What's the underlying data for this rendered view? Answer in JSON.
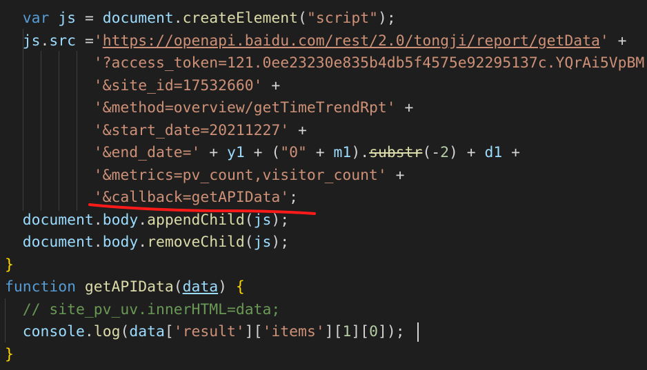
{
  "editor": {
    "lines": [
      [
        {
          "text": "  "
        },
        {
          "text": "var",
          "cls": "k"
        },
        {
          "text": " "
        },
        {
          "text": "js",
          "cls": "v"
        },
        {
          "text": " = "
        },
        {
          "text": "document",
          "cls": "v"
        },
        {
          "text": "."
        },
        {
          "text": "createElement",
          "cls": "f"
        },
        {
          "text": "("
        },
        {
          "text": "\"script\"",
          "cls": "s"
        },
        {
          "text": ");"
        }
      ],
      [
        {
          "text": "  "
        },
        {
          "text": "js",
          "cls": "v"
        },
        {
          "text": "."
        },
        {
          "text": "src",
          "cls": "v"
        },
        {
          "text": " ="
        },
        {
          "text": "'",
          "cls": "s"
        },
        {
          "text": "https://openapi.baidu.com/rest/2.0/tongji/report/getData",
          "cls": "s link"
        },
        {
          "text": "'",
          "cls": "s"
        },
        {
          "text": " +"
        }
      ],
      [
        {
          "text": "          "
        },
        {
          "text": "'?access_token=121.0ee23230e835b4db5f4575e92295137c.YQrAi5VpBM",
          "cls": "s"
        }
      ],
      [
        {
          "text": "          "
        },
        {
          "text": "'&site_id=17532660'",
          "cls": "s"
        },
        {
          "text": " +"
        }
      ],
      [
        {
          "text": "          "
        },
        {
          "text": "'&method=overview/getTimeTrendRpt'",
          "cls": "s"
        },
        {
          "text": " +"
        }
      ],
      [
        {
          "text": "          "
        },
        {
          "text": "'&start_date=20211227'",
          "cls": "s"
        },
        {
          "text": " +"
        }
      ],
      [
        {
          "text": "          "
        },
        {
          "text": "'&end_date='",
          "cls": "s"
        },
        {
          "text": " + "
        },
        {
          "text": "y1",
          "cls": "v"
        },
        {
          "text": " + ("
        },
        {
          "text": "\"0\"",
          "cls": "s"
        },
        {
          "text": " + "
        },
        {
          "text": "m1",
          "cls": "v"
        },
        {
          "text": ")."
        },
        {
          "text": "substr",
          "cls": "f strike"
        },
        {
          "text": "(-"
        },
        {
          "text": "2",
          "cls": "n"
        },
        {
          "text": ") + "
        },
        {
          "text": "d1",
          "cls": "v"
        },
        {
          "text": " +"
        }
      ],
      [
        {
          "text": "          "
        },
        {
          "text": "'&metrics=pv_count,visitor_count'",
          "cls": "s"
        },
        {
          "text": " +"
        }
      ],
      [
        {
          "text": "          "
        },
        {
          "text": "'&callback=getAPIData'",
          "cls": "s"
        },
        {
          "text": ";"
        }
      ],
      [
        {
          "text": "  "
        },
        {
          "text": "document",
          "cls": "v"
        },
        {
          "text": "."
        },
        {
          "text": "body",
          "cls": "v"
        },
        {
          "text": "."
        },
        {
          "text": "appendChild",
          "cls": "f"
        },
        {
          "text": "("
        },
        {
          "text": "js",
          "cls": "v"
        },
        {
          "text": ");"
        }
      ],
      [
        {
          "text": "  "
        },
        {
          "text": "document",
          "cls": "v"
        },
        {
          "text": "."
        },
        {
          "text": "body",
          "cls": "v"
        },
        {
          "text": "."
        },
        {
          "text": "removeChild",
          "cls": "f"
        },
        {
          "text": "("
        },
        {
          "text": "js",
          "cls": "v"
        },
        {
          "text": ");"
        }
      ],
      [
        {
          "text": "}",
          "cls": "y"
        }
      ],
      [
        {
          "text": "function",
          "cls": "k"
        },
        {
          "text": " "
        },
        {
          "text": "getAPIData",
          "cls": "f"
        },
        {
          "text": "("
        },
        {
          "text": "data",
          "cls": "v link"
        },
        {
          "text": ") "
        },
        {
          "text": "{",
          "cls": "y"
        }
      ],
      [
        {
          "text": "  "
        },
        {
          "text": "// site_pv_uv.innerHTML=data;",
          "cls": "c"
        }
      ],
      [
        {
          "text": "  "
        },
        {
          "text": "console",
          "cls": "v"
        },
        {
          "text": "."
        },
        {
          "text": "log",
          "cls": "f"
        },
        {
          "text": "("
        },
        {
          "text": "data",
          "cls": "v"
        },
        {
          "text": "["
        },
        {
          "text": "'result'",
          "cls": "s"
        },
        {
          "text": "]["
        },
        {
          "text": "'items'",
          "cls": "s"
        },
        {
          "text": "]["
        },
        {
          "text": "1",
          "cls": "n"
        },
        {
          "text": "]["
        },
        {
          "text": "0",
          "cls": "n"
        },
        {
          "text": "]);"
        }
      ],
      [
        {
          "text": "}",
          "cls": "y"
        }
      ]
    ]
  },
  "annotation": {
    "color": "#ff1a1a"
  }
}
